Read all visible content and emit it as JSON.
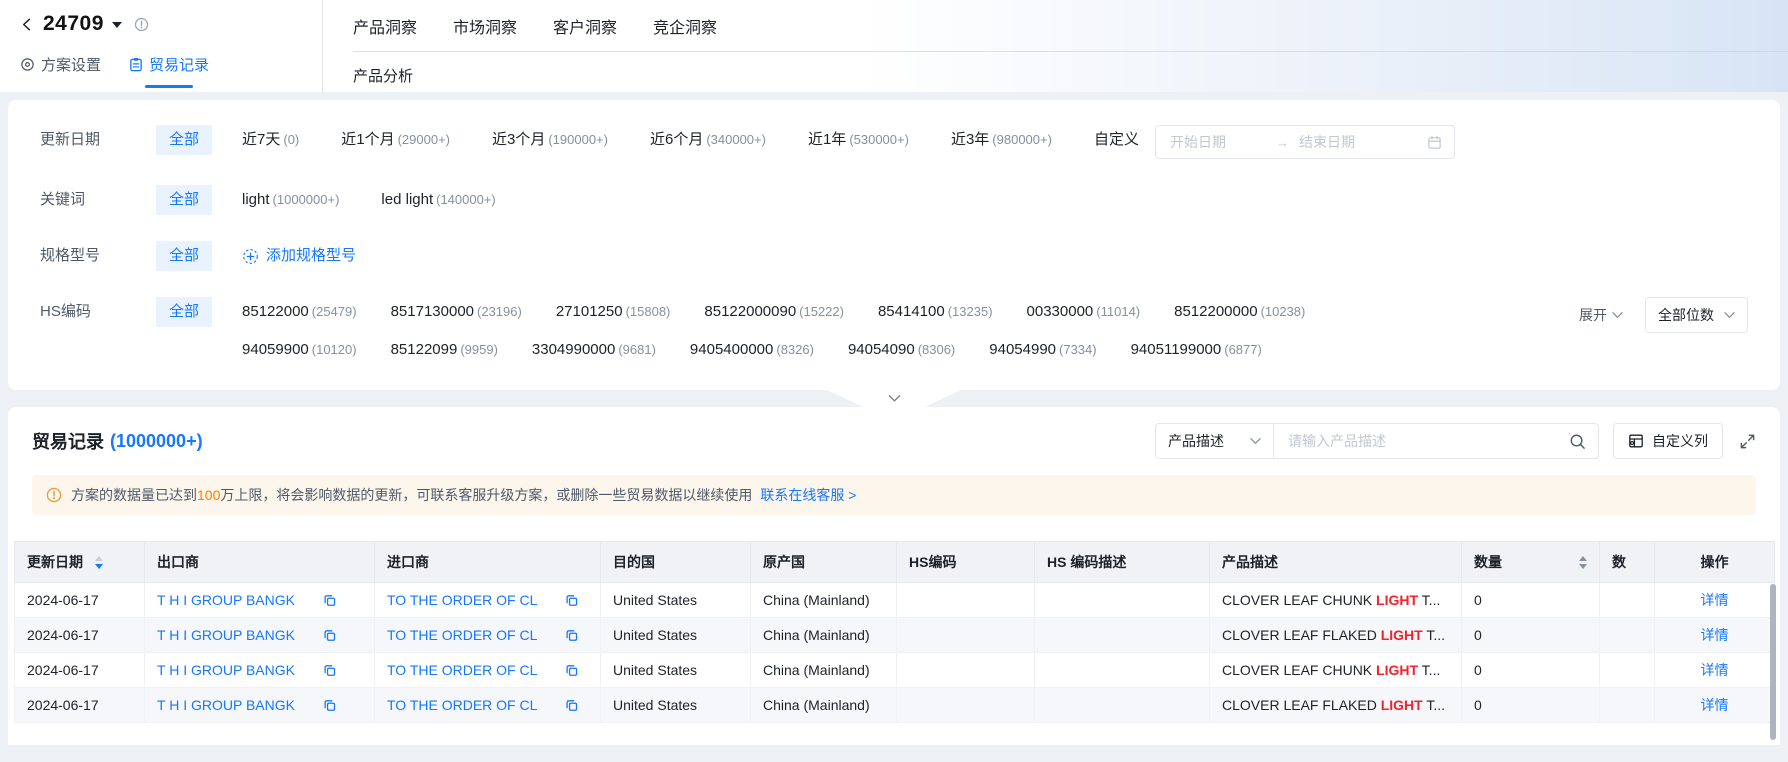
{
  "colors": {
    "accent": "#1677FF",
    "chip_bg": "#E8F3FF",
    "warning_orange": "#FF7D00",
    "notice_bg": "#FCF6EC",
    "highlight_red": "#F5222D",
    "link_blue": "#1677FF"
  },
  "icons": {
    "back": "chevron-left",
    "plan_dropdown": "caret-down",
    "info": "circle-exclamation",
    "settings": "gear-target",
    "trade_records": "clipboard",
    "range_arrow": "→",
    "calendar": "calendar",
    "add": "plus-dashed-circle",
    "chevron": "∨",
    "search": "magnifier",
    "customize": "table-settings",
    "fullscreen": "corner-arrows",
    "warning": "circle-exclamation",
    "copy": "copy",
    "sort": "caret-up-down",
    "collapse": "chevron-down"
  },
  "header": {
    "plan_id": "24709",
    "subtabs": [
      {
        "label": "方案设置",
        "active": false
      },
      {
        "label": "贸易记录",
        "active": true
      }
    ],
    "nav_tabs": [
      {
        "label": "产品洞察"
      },
      {
        "label": "市场洞察"
      },
      {
        "label": "客户洞察"
      },
      {
        "label": "竞企洞察"
      }
    ],
    "sub_nav": "产品分析"
  },
  "filters": {
    "update_date": {
      "label": "更新日期",
      "all_label": "全部",
      "options": [
        {
          "name": "近7天",
          "count": "(0)"
        },
        {
          "name": "近1个月",
          "count": "(29000+)"
        },
        {
          "name": "近3个月",
          "count": "(190000+)"
        },
        {
          "name": "近6个月",
          "count": "(340000+)"
        },
        {
          "name": "近1年",
          "count": "(530000+)"
        },
        {
          "name": "近3年",
          "count": "(980000+)"
        }
      ],
      "custom_label": "自定义",
      "start_placeholder": "开始日期",
      "end_placeholder": "结束日期"
    },
    "keyword": {
      "label": "关键词",
      "all_label": "全部",
      "options": [
        {
          "name": "light",
          "count": "(1000000+)"
        },
        {
          "name": "led light",
          "count": "(140000+)"
        }
      ]
    },
    "spec": {
      "label": "规格型号",
      "all_label": "全部",
      "add_label": "添加规格型号"
    },
    "hs_code": {
      "label": "HS编码",
      "all_label": "全部",
      "options": [
        {
          "name": "85122000",
          "count": "(25479)"
        },
        {
          "name": "8517130000",
          "count": "(23196)"
        },
        {
          "name": "27101250",
          "count": "(15808)"
        },
        {
          "name": "85122000090",
          "count": "(15222)"
        },
        {
          "name": "85414100",
          "count": "(13235)"
        },
        {
          "name": "00330000",
          "count": "(11014)"
        },
        {
          "name": "8512200000",
          "count": "(10238)"
        },
        {
          "name": "94059900",
          "count": "(10120)"
        },
        {
          "name": "85122099",
          "count": "(9959)"
        },
        {
          "name": "3304990000",
          "count": "(9681)"
        },
        {
          "name": "9405400000",
          "count": "(8326)"
        },
        {
          "name": "94054090",
          "count": "(8306)"
        },
        {
          "name": "94054990",
          "count": "(7334)"
        },
        {
          "name": "94051199000",
          "count": "(6877)"
        }
      ],
      "expand_label": "展开",
      "digits_label": "全部位数"
    }
  },
  "records": {
    "title": "贸易记录",
    "count": "(1000000+)",
    "search": {
      "field": "产品描述",
      "placeholder": "请输入产品描述"
    },
    "customize_label": "自定义列",
    "notice": {
      "text_before": "方案的数据量已达到",
      "highlight": "100",
      "text_after": "万上限，将会影响数据的更新，可联系客服升级方案，或删除一些贸易数据以继续使用",
      "link": "联系在线客服 >"
    },
    "table": {
      "headers": {
        "date": "更新日期",
        "exporter": "出口商",
        "importer": "进口商",
        "destination": "目的国",
        "origin": "原产国",
        "hs_code": "HS编码",
        "hs_desc": "HS 编码描述",
        "product": "产品描述",
        "quantity": "数量",
        "quantity_clipped": "数",
        "action": "操作"
      },
      "rows": [
        {
          "date": "2024-06-17",
          "exporter": "T H I GROUP BANGK",
          "importer": "TO THE ORDER OF CL",
          "destination": "United States",
          "origin": "China (Mainland)",
          "hs_code": "",
          "hs_desc": "",
          "product_before": "CLOVER LEAF CHUNK ",
          "product_match": "LIGHT",
          "product_after": " T...",
          "quantity": "0",
          "action": "详情"
        },
        {
          "date": "2024-06-17",
          "exporter": "T H I GROUP BANGK",
          "importer": "TO THE ORDER OF CL",
          "destination": "United States",
          "origin": "China (Mainland)",
          "hs_code": "",
          "hs_desc": "",
          "product_before": "CLOVER LEAF FLAKED ",
          "product_match": "LIGHT",
          "product_after": " T...",
          "quantity": "0",
          "action": "详情"
        },
        {
          "date": "2024-06-17",
          "exporter": "T H I GROUP BANGK",
          "importer": "TO THE ORDER OF CL",
          "destination": "United States",
          "origin": "China (Mainland)",
          "hs_code": "",
          "hs_desc": "",
          "product_before": "CLOVER LEAF CHUNK ",
          "product_match": "LIGHT",
          "product_after": " T...",
          "quantity": "0",
          "action": "详情"
        },
        {
          "date": "2024-06-17",
          "exporter": "T H I GROUP BANGK",
          "importer": "TO THE ORDER OF CL",
          "destination": "United States",
          "origin": "China (Mainland)",
          "hs_code": "",
          "hs_desc": "",
          "product_before": "CLOVER LEAF FLAKED ",
          "product_match": "LIGHT",
          "product_after": " T...",
          "quantity": "0",
          "action": "详情"
        }
      ]
    }
  }
}
